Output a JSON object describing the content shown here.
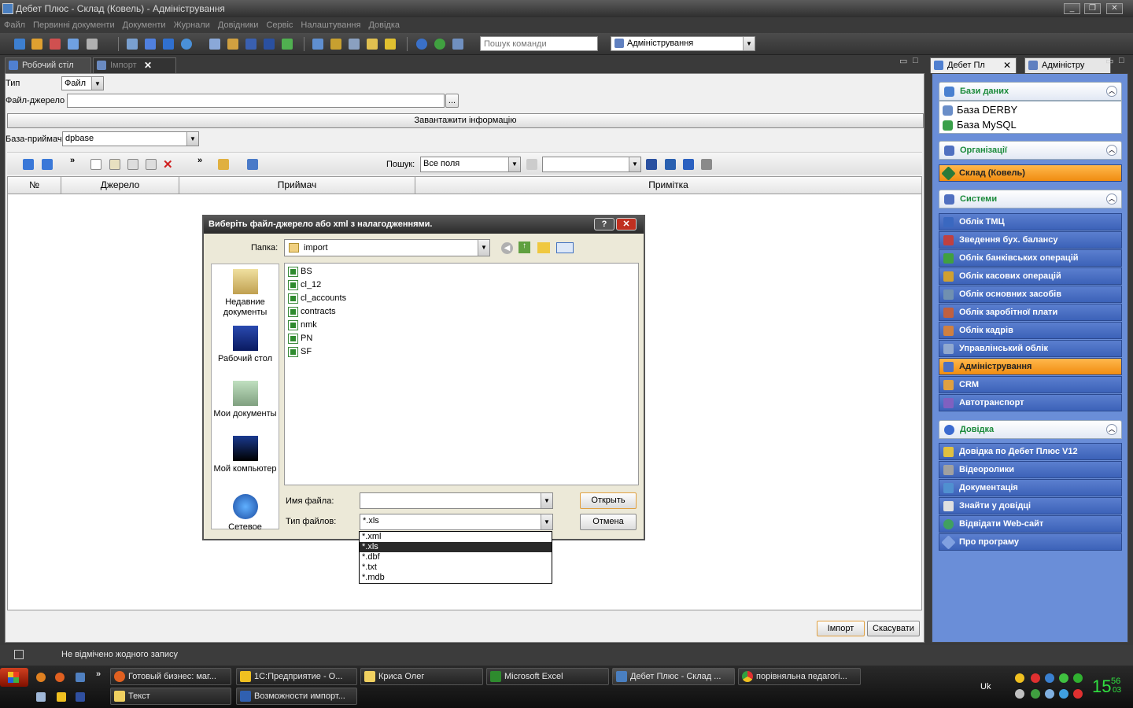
{
  "window": {
    "title": "Дебет Плюс - Склад (Ковель) - Адміністрування"
  },
  "menu": [
    "Файл",
    "Первинні документи",
    "Документи",
    "Журнали",
    "Довідники",
    "Сервіс",
    "Налаштування",
    "Довідка"
  ],
  "toolbar": {
    "search_placeholder": "Пошук команди",
    "mode": "Адміністрування"
  },
  "tabs": {
    "desktop": "Робочий стіл",
    "import": "Імпорт"
  },
  "form": {
    "type_label": "Тип",
    "type_value": "Файл",
    "source_label": "Файл-джерело",
    "browse": "...",
    "load_button": "Завантажити інформацію",
    "target_label": "База-приймач",
    "target_value": "dpbase",
    "search_label": "Пошук:",
    "search_scope": "Все поля"
  },
  "grid": {
    "columns": [
      "№",
      "Джерело",
      "Приймач",
      "Примітка"
    ]
  },
  "buttons": {
    "import": "Імпорт",
    "cancel": "Скасувати"
  },
  "status": {
    "text": "Не відмічено жодного запису"
  },
  "right": {
    "tabs": [
      "Дебет Пл",
      "Адміністру"
    ],
    "sections": {
      "databases": {
        "title": "Бази даних",
        "items": [
          "База DERBY",
          "База MySQL"
        ]
      },
      "orgs": {
        "title": "Організації",
        "items": [
          "Склад (Ковель)"
        ]
      },
      "systems": {
        "title": "Системи",
        "items": [
          "Облік ТМЦ",
          "Зведення бух. балансу",
          "Облік банківських операцій",
          "Облік касових операцій",
          "Облік основних засобів",
          "Облік заробітної плати",
          "Облік кадрів",
          "Управлінський облік",
          "Адміністрування",
          "CRM",
          "Автотранспорт"
        ]
      },
      "help": {
        "title": "Довідка",
        "items": [
          "Довідка по Дебет Плюс V12",
          "Відеоролики",
          "Документація",
          "Знайти у довідці",
          "Відвідати Web-сайт",
          "Про програму"
        ]
      }
    }
  },
  "dialog": {
    "title": "Виберіть файл-джерело або xml з налагодженнями.",
    "help_btn": "?",
    "close_btn": "✕",
    "folder_label": "Папка:",
    "folder_value": "import",
    "places": [
      "Недавние документы",
      "Рабочий стол",
      "Мои документы",
      "Мой компьютер",
      "Сетевое"
    ],
    "files": [
      "BS",
      "cl_12",
      "cl_accounts",
      "contracts",
      "nmk",
      "PN",
      "SF"
    ],
    "filename_label": "Имя файла:",
    "filename_value": "",
    "filetype_label": "Тип файлов:",
    "filetype_value": "*.xls",
    "filetype_options": [
      "*.xml",
      "*.xls",
      "*.dbf",
      "*.txt",
      "*.mdb"
    ],
    "open_btn": "Открыть",
    "cancel_btn": "Отмена"
  },
  "taskbar": {
    "tasks_row1": [
      "Готовый бизнес: маг...",
      "1С:Предприятие - О...",
      "Криса Олег",
      "Microsoft Excel",
      "Дебет Плюс - Склад ...",
      "порівняльна педагогі..."
    ],
    "tasks_row2": [
      "Текст",
      "Возможности импорт..."
    ],
    "lang": "Uk",
    "clock_hour": "15",
    "clock_min": "56",
    "clock_sec": "03"
  }
}
